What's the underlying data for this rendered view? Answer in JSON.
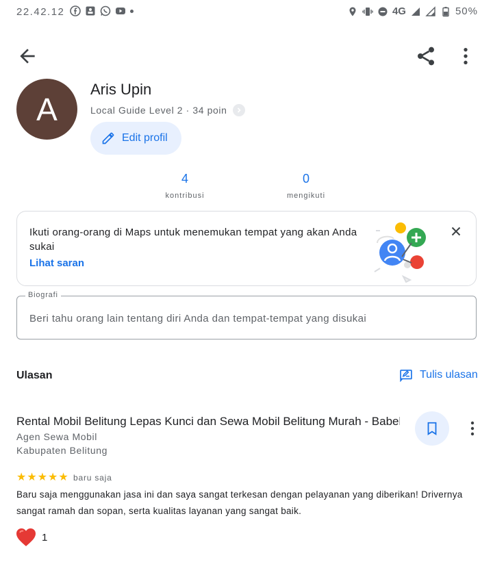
{
  "status_bar": {
    "time": "22.42.12",
    "network": "4G",
    "battery": "50%",
    "left_icons": [
      "facebook-icon",
      "photo-icon",
      "whatsapp-icon",
      "youtube-icon"
    ],
    "right_icons": [
      "location-icon",
      "vibrate-icon",
      "dnd-icon",
      "signal-icon",
      "battery-icon"
    ]
  },
  "app_bar": {
    "icons": [
      "back-arrow-icon",
      "share-icon",
      "more-vert-icon"
    ]
  },
  "profile": {
    "avatar_letter": "A",
    "avatar_color": "#5d4037",
    "name": "Aris Upin",
    "level": "Local Guide Level 2 · 34 poin",
    "edit_label": "Edit profil"
  },
  "stats": [
    {
      "value": "4",
      "label": "kontribusi"
    },
    {
      "value": "0",
      "label": "mengikuti"
    }
  ],
  "suggestion_card": {
    "message": "Ikuti orang-orang di Maps untuk menemukan tempat yang akan Anda sukai",
    "link": "Lihat saran"
  },
  "bio": {
    "legend": "Biografi",
    "placeholder": "Beri tahu orang lain tentang diri Anda dan tempat-tempat yang disukai"
  },
  "reviews": {
    "title": "Ulasan",
    "write_label": "Tulis ulasan",
    "items": [
      {
        "place": "Rental Mobil Belitung Lepas Kunci dan Sewa Mobil Belitung Murah - Babel...",
        "category": "Agen Sewa Mobil",
        "location": "Kabupaten Belitung",
        "rating": 5,
        "time": "baru saja",
        "text": "Baru saja menggunakan jasa ini dan saya sangat terkesan dengan pelayanan yang diberikan! Drivernya sangat ramah dan sopan, serta kualitas layanan yang sangat baik.",
        "likes": "1"
      }
    ]
  },
  "colors": {
    "accent": "#1a73e8",
    "star": "#fbbc04",
    "heart": "#e53935"
  }
}
